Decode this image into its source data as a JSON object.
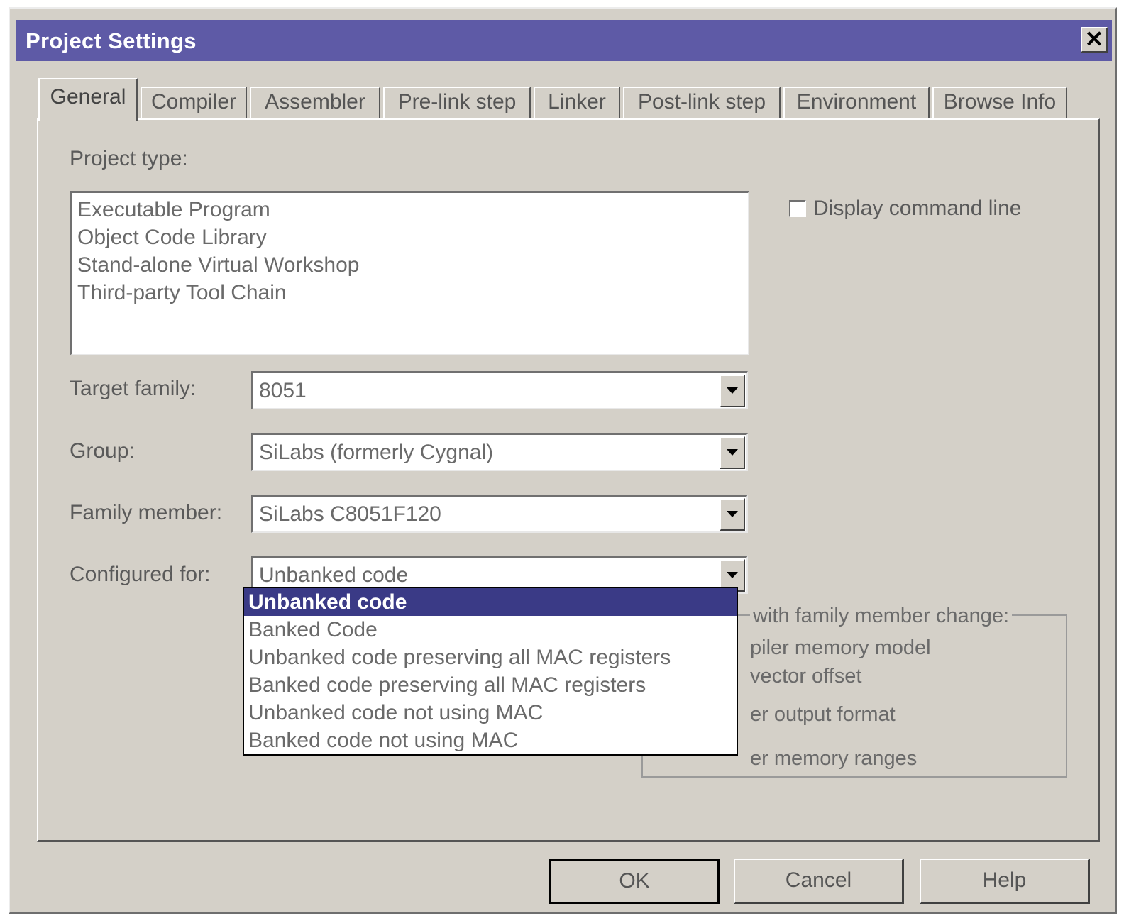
{
  "window": {
    "title": "Project Settings",
    "close_label": "✕"
  },
  "tabs": [
    {
      "label": "General",
      "active": true
    },
    {
      "label": "Compiler"
    },
    {
      "label": "Assembler"
    },
    {
      "label": "Pre-link step"
    },
    {
      "label": "Linker"
    },
    {
      "label": "Post-link step"
    },
    {
      "label": "Environment"
    },
    {
      "label": "Browse Info"
    }
  ],
  "general": {
    "project_type_label": "Project type:",
    "project_types": [
      "Executable Program",
      "Object Code Library",
      "Stand-alone Virtual Workshop",
      "Third-party Tool Chain"
    ],
    "display_command_line_label": "Display command line",
    "display_command_line_checked": false,
    "target_family_label": "Target family:",
    "target_family_value": "8051",
    "group_label": "Group:",
    "group_value": "SiLabs (formerly Cygnal)",
    "family_member_label": "Family member:",
    "family_member_value": "SiLabs C8051F120",
    "configured_for_label": "Configured for:",
    "configured_for_value": "Unbanked code",
    "configured_for_options": [
      "Unbanked code",
      "Banked Code",
      "Unbanked code preserving all MAC registers",
      "Banked code preserving all MAC registers",
      "Unbanked code not using MAC",
      "Banked code not using MAC"
    ],
    "groupbox_title_visible": "with family member change:",
    "groupbox_items_visible": [
      "piler memory model",
      "vector offset",
      "er output format",
      "er memory ranges"
    ]
  },
  "buttons": {
    "ok": "OK",
    "cancel": "Cancel",
    "help": "Help"
  }
}
